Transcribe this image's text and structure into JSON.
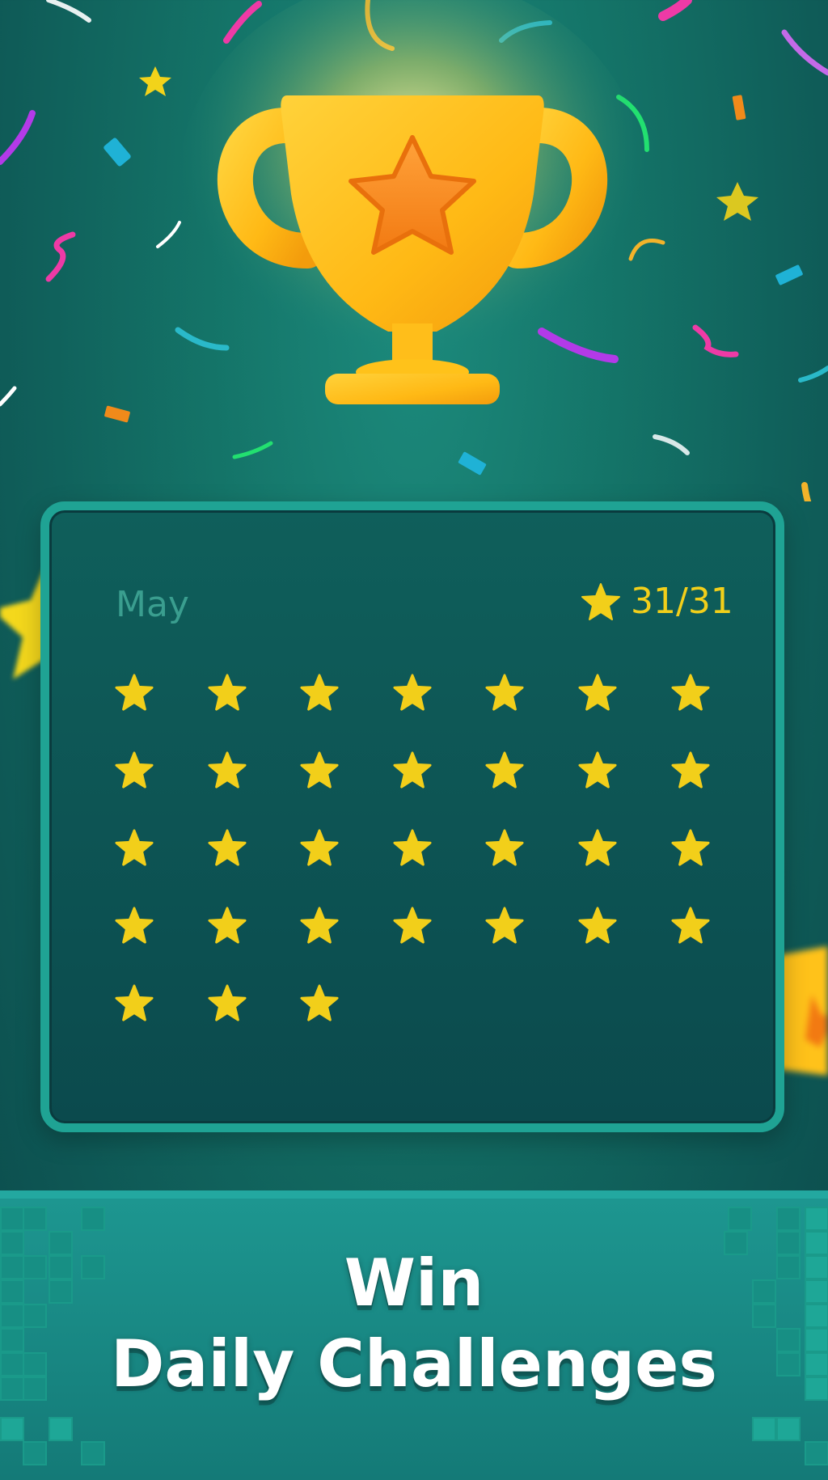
{
  "calendar": {
    "month": "May",
    "score_text": "31/31",
    "days_total": 31,
    "days_completed": 31
  },
  "banner": {
    "line1": "Win",
    "line2": "Daily Challenges"
  },
  "colors": {
    "star_yellow": "#f2cf1a",
    "card_border": "#1fa394",
    "background": "#147468",
    "trophy_gold": "#ffc21a"
  },
  "icons": [
    "trophy-icon",
    "star-icon"
  ]
}
